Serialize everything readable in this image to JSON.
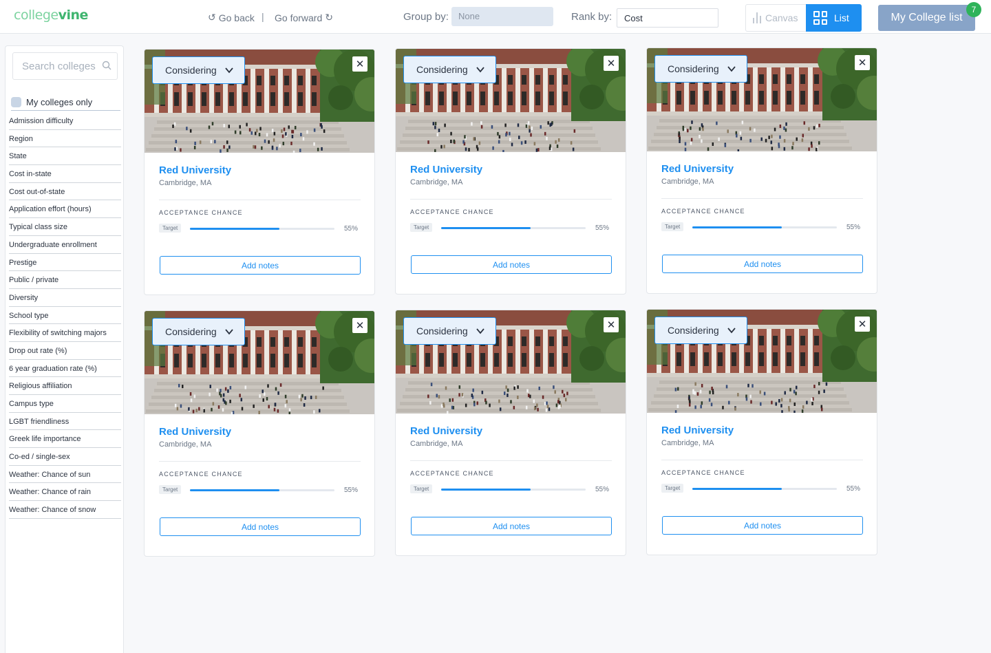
{
  "header": {
    "logo": {
      "part1": "college",
      "part2": "vine"
    },
    "go_back": "Go back",
    "separator": "|",
    "go_forward": "Go forward",
    "group_by_label": "Group by:",
    "group_by_value": "None",
    "rank_by_label": "Rank by:",
    "rank_by_value": "Cost",
    "view_canvas": "Canvas",
    "view_list": "List",
    "my_college_list": "My College list",
    "list_count": "7"
  },
  "sidebar": {
    "search_placeholder": "Search colleges",
    "my_colleges_only": "My colleges only",
    "filters": [
      "Admission difficulty",
      "Region",
      "State",
      "Cost in-state",
      "Cost out-of-state",
      "Application effort (hours)",
      "Typical class size",
      "Undergraduate enrollment",
      "Prestige",
      "Public / private",
      "Diversity",
      "School type",
      "Flexibility of switching majors",
      "Drop out rate (%)",
      "6 year graduation rate (%)",
      "Religious affiliation",
      "Campus type",
      "LGBT friendliness",
      "Greek life importance",
      "Co-ed / single-sex",
      "Weather: Chance of sun",
      "Weather: Chance of rain",
      "Weather: Chance of snow"
    ]
  },
  "cards": [
    {
      "status": "Considering",
      "name": "Red University",
      "location": "Cambridge, MA",
      "acceptance_label": "ACCEPTANCE CHANCE",
      "category": "Target",
      "chance": 55,
      "chance_text": "55%",
      "notes_label": "Add notes"
    },
    {
      "status": "Considering",
      "name": "Red University",
      "location": "Cambridge, MA",
      "acceptance_label": "ACCEPTANCE CHANCE",
      "category": "Target",
      "chance": 55,
      "chance_text": "55%",
      "notes_label": "Add notes"
    },
    {
      "status": "Considering",
      "name": "Red University",
      "location": "Cambridge, MA",
      "acceptance_label": "ACCEPTANCE CHANCE",
      "category": "Target",
      "chance": 55,
      "chance_text": "55%",
      "notes_label": "Add notes"
    },
    {
      "status": "Considering",
      "name": "Red University",
      "location": "Cambridge, MA",
      "acceptance_label": "ACCEPTANCE CHANCE",
      "category": "Target",
      "chance": 55,
      "chance_text": "55%",
      "notes_label": "Add notes"
    },
    {
      "status": "Considering",
      "name": "Red University",
      "location": "Cambridge, MA",
      "acceptance_label": "ACCEPTANCE CHANCE",
      "category": "Target",
      "chance": 55,
      "chance_text": "55%",
      "notes_label": "Add notes"
    },
    {
      "status": "Considering",
      "name": "Red University",
      "location": "Cambridge, MA",
      "acceptance_label": "ACCEPTANCE CHANCE",
      "category": "Target",
      "chance": 55,
      "chance_text": "55%",
      "notes_label": "Add notes"
    }
  ],
  "icons": {
    "back": "undo-arrow-icon",
    "forward": "redo-arrow-icon",
    "canvas": "bar-chart-icon",
    "list": "grid-icon",
    "search": "search-icon",
    "status_toggle": "chevron-down-icon",
    "remove": "close-icon"
  },
  "colors": {
    "accent": "#1e8ff0",
    "brand_green": "#3fb56f",
    "badge": "#2fb35a",
    "my_list_button": "#88a4c8"
  }
}
